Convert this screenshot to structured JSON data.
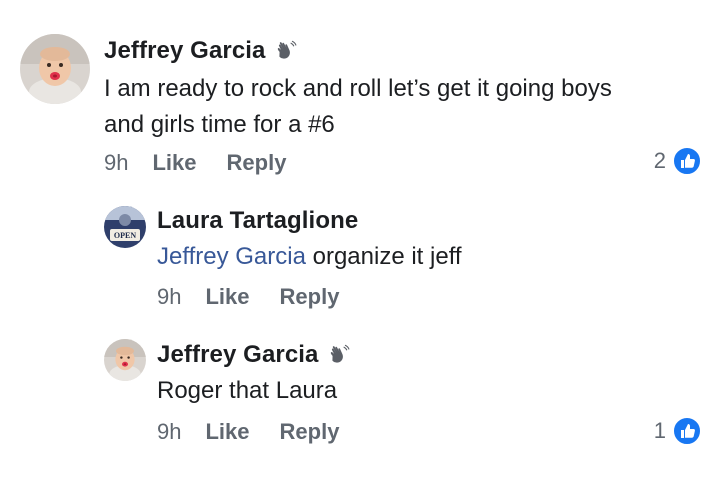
{
  "comments": [
    {
      "author": "Jeffrey Garcia",
      "author_badge_icon": "waving-hand-icon",
      "text_lines": [
        "I am ready to rock and roll let’s get it going boys",
        "and girls time for a #6"
      ],
      "time": "9h",
      "like_label": "Like",
      "reply_label": "Reply",
      "reaction_count": "2",
      "reaction_icon": "like-thumb-icon"
    },
    {
      "author": "Laura Tartaglione",
      "mention": "Jeffrey Garcia",
      "text": " organize it jeff",
      "time": "9h",
      "like_label": "Like",
      "reply_label": "Reply",
      "avatar_badge_text": "OPEN"
    },
    {
      "author": "Jeffrey Garcia",
      "author_badge_icon": "waving-hand-icon",
      "text": "Roger that Laura",
      "time": "9h",
      "like_label": "Like",
      "reply_label": "Reply",
      "reaction_count": "1",
      "reaction_icon": "like-thumb-icon"
    }
  ],
  "colors": {
    "mention": "#385898",
    "meta": "#606770",
    "like_blue": "#1877f2"
  }
}
